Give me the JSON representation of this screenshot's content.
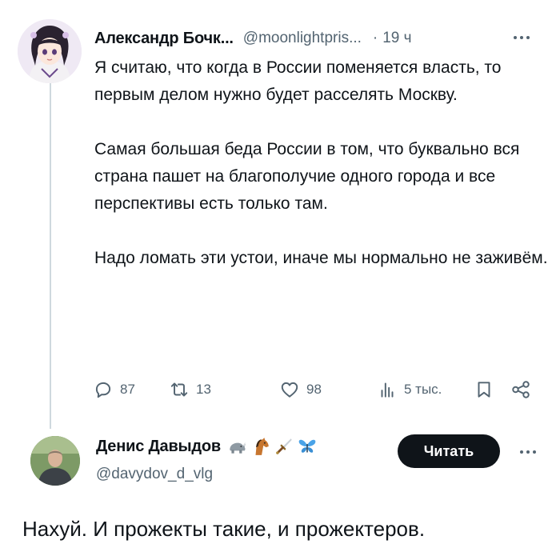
{
  "tweet": {
    "author_name": "Александр Бочк...",
    "author_handle": "@moonlightpris...",
    "separator": "·",
    "time": "19 ч",
    "avatar_icon": "anime-girl-avatar",
    "paragraphs": [
      "Я считаю, что когда в России поменяется власть, то первым делом нужно будет расселять Москву.",
      "Самая большая беда России в том, что буквально вся страна пашет на благополучие одного города и все перспективы есть только там.",
      "Надо ломать эти устои, иначе мы нормально не заживём."
    ],
    "stats": {
      "replies": "87",
      "retweets": "13",
      "likes": "98",
      "views": "5 тыс."
    }
  },
  "reply": {
    "author_name": "Денис Давыдов",
    "author_handle": "@davydov_d_vlg",
    "emojis": [
      "rhino-emoji",
      "horse-emoji",
      "dagger-emoji",
      "butterfly-emoji"
    ],
    "follow_label": "Читать",
    "text": "Нахуй. И прожекты такие, и прожектеров."
  },
  "colors": {
    "text": "#0f1419",
    "secondary": "#536471",
    "thread_line": "#cfd9de",
    "button_bg": "#0f1419"
  }
}
